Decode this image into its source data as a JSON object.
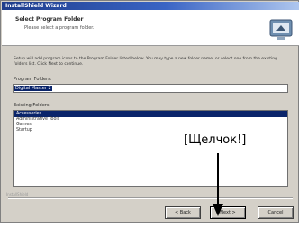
{
  "window": {
    "title": "InstallShield Wizard"
  },
  "header": {
    "title": "Select Program Folder",
    "subtitle": "Please select a program folder."
  },
  "intro": {
    "text": "Setup will add program icons to the Program Folder listed below. You may type a new folder name, or select one from the existing folders list. Click Next to continue."
  },
  "program_folder": {
    "label": "Program Folders:",
    "value": "Digital Master 2"
  },
  "existing_folders": {
    "label": "Existing Folders:",
    "items": [
      {
        "label": "Accessories",
        "selected": true
      },
      {
        "label": "Administrative Tools",
        "selected": false
      },
      {
        "label": "Games",
        "selected": false
      },
      {
        "label": "Startup",
        "selected": false
      }
    ]
  },
  "footer": {
    "brand": "InstallShield"
  },
  "buttons": {
    "back": "< Back",
    "next": "Next >",
    "cancel": "Cancel"
  },
  "annotation": {
    "callout": "[Щелчок!]"
  },
  "colors": {
    "titlebar_start": "#1f3d8c",
    "selection": "#0a246a",
    "dialog_bg": "#d4d0c8"
  }
}
